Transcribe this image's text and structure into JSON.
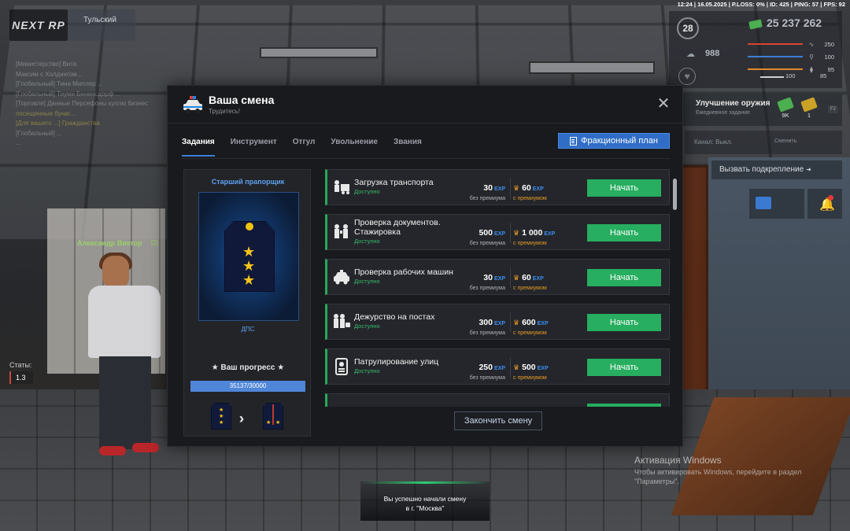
{
  "hud": {
    "logo": "NEXT RP",
    "logo_sub": "",
    "city": "Тульский",
    "city_sub": "",
    "status_bar": "12:24 | 16.05.2025 | P.LOSS: 0% | ID: 425 | PING: 57 | FPS: 92",
    "level": "28",
    "money": "25 237 262",
    "health": "250",
    "stamina": "100",
    "hunger_val": "95",
    "wallet": "988",
    "armor": "100",
    "shield": "85",
    "weapon_title": "Улучшение оружия",
    "weapon_sub": "Ежедневное задание",
    "weapon_reward1": "9K",
    "weapon_reward2": "1",
    "channel": "Канал: Выкл.",
    "channel_switch": "Сменить",
    "backup": "Вызвать подкрепление",
    "stats_label": "Статы:",
    "stats_value": "1.3",
    "name_tag": "Александр Виктор",
    "name_tag_id": "[2]"
  },
  "chat": [
    {
      "text": "[Министерство] Вита",
      "color": "gray"
    },
    {
      "text": "Максим с Холдингом...",
      "color": "gray"
    },
    {
      "text": "[Глобальный] Тина Миллер ...",
      "color": "gray"
    },
    {
      "text": "[Глобальный] Тиуми Бененсдорф ...",
      "color": "gray"
    },
    {
      "text": "[Торговля] Данные Персефоны куплю бизнес",
      "color": "gray"
    },
    {
      "text": "посещенные бунаг...",
      "color": "yellow"
    },
    {
      "text": "[Для вашего ...] Гражданства",
      "color": "yellow"
    },
    {
      "text": "[Глобальный] ...",
      "color": "gray"
    },
    {
      "text": "...",
      "color": "gray"
    }
  ],
  "modal": {
    "title": "Ваша смена",
    "subtitle": "Трудитесь!",
    "tabs": [
      "Задания",
      "Инструмент",
      "Отгул",
      "Увольнение",
      "Звания"
    ],
    "active_tab": "Задания",
    "faction_button": "Фракционный план",
    "rank_name": "Старший прапорщик",
    "rank_department": "ДПС",
    "progress_label": "★ Ваш прогресс ★",
    "progress_text": "35137/30000",
    "progress_fraction": 1.0,
    "end_shift": "Закончить смену",
    "tasks": [
      {
        "name": "Загрузка транспорта",
        "status": "Доступно",
        "base": "30",
        "premium": "60",
        "icon": "truck-loading-icon"
      },
      {
        "name": "Проверка документов. Стажировка",
        "status": "Доступно",
        "base": "500",
        "premium": "1 000",
        "icon": "document-check-icon"
      },
      {
        "name": "Проверка рабочих машин",
        "status": "Доступно",
        "base": "30",
        "premium": "60",
        "icon": "police-car-icon"
      },
      {
        "name": "Дежурство на постах",
        "status": "Доступно",
        "base": "300",
        "premium": "600",
        "icon": "post-duty-icon"
      },
      {
        "name": "Патрулирование улиц",
        "status": "Доступно",
        "base": "250",
        "premium": "500",
        "icon": "patrol-icon"
      }
    ],
    "exp_tag": "EXP",
    "base_caption": "без премиума",
    "premium_caption": "с премиумом",
    "start_label": "Начать"
  },
  "activation": {
    "title": "Активация Windows",
    "text1": "Чтобы активировать Windows, перейдите в раздел",
    "text2": "\"Параметры\"."
  },
  "toast": {
    "line1": "Вы успешно начали смену",
    "line2": "в г. \"Москва\""
  },
  "colors": {
    "accent": "#2f6dc6",
    "start_button": "#27ae60",
    "status_ok": "#39b86a",
    "exp": "#3b8ff0",
    "premium": "#e39a26"
  }
}
